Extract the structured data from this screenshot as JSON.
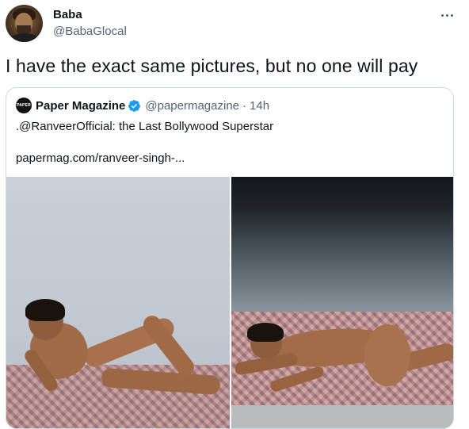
{
  "author": {
    "display_name": "Baba",
    "handle": "@BabaGlocal"
  },
  "tweet": {
    "text": "I have the exact same pictures, but no one will pay"
  },
  "quoted_tweet": {
    "avatar_text": "PAPER",
    "display_name": "Paper Magazine",
    "handle": "@papermagazine",
    "separator": "·",
    "time": "14h",
    "text": ".@RanveerOfficial: the Last Bollywood Superstar",
    "link": "papermag.com/ranveer-singh-...",
    "verified_color": "#1d9bf0"
  },
  "icons": {
    "more": "more-horizontal-icon",
    "verified": "verified-badge-icon"
  },
  "colors": {
    "text_primary": "#0f1419",
    "text_secondary": "#536471",
    "border": "#cfd9de"
  }
}
